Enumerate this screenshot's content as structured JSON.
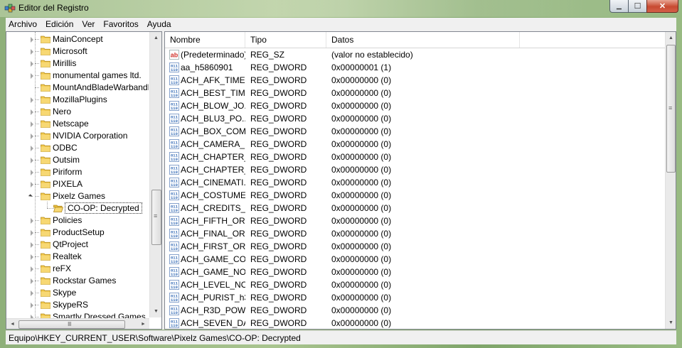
{
  "window": {
    "title": "Editor del Registro",
    "minimize_glyph": "▁",
    "maximize_glyph": "☐",
    "close_glyph": "✕"
  },
  "menu": [
    "Archivo",
    "Edición",
    "Ver",
    "Favoritos",
    "Ayuda"
  ],
  "tree": {
    "items": [
      {
        "label": "MainConcept",
        "state": "collapsed"
      },
      {
        "label": "Microsoft",
        "state": "collapsed"
      },
      {
        "label": "Mirillis",
        "state": "collapsed"
      },
      {
        "label": "monumental games ltd.",
        "state": "collapsed"
      },
      {
        "label": "MountAndBladeWarbandKeys",
        "state": "leaf"
      },
      {
        "label": "MozillaPlugins",
        "state": "collapsed"
      },
      {
        "label": "Nero",
        "state": "collapsed"
      },
      {
        "label": "Netscape",
        "state": "collapsed"
      },
      {
        "label": "NVIDIA Corporation",
        "state": "collapsed"
      },
      {
        "label": "ODBC",
        "state": "collapsed"
      },
      {
        "label": "Outsim",
        "state": "collapsed"
      },
      {
        "label": "Piriform",
        "state": "collapsed"
      },
      {
        "label": "PIXELA",
        "state": "collapsed"
      },
      {
        "label": "Pixelz Games",
        "state": "expanded"
      },
      {
        "label": "CO-OP: Decrypted",
        "state": "selected-child"
      },
      {
        "label": "Policies",
        "state": "collapsed"
      },
      {
        "label": "ProductSetup",
        "state": "collapsed"
      },
      {
        "label": "QtProject",
        "state": "collapsed"
      },
      {
        "label": "Realtek",
        "state": "collapsed"
      },
      {
        "label": "reFX",
        "state": "collapsed"
      },
      {
        "label": "Rockstar Games",
        "state": "collapsed"
      },
      {
        "label": "Skype",
        "state": "collapsed"
      },
      {
        "label": "SkypeRS",
        "state": "collapsed"
      },
      {
        "label": "Smartly Dressed Games",
        "state": "collapsed"
      }
    ],
    "scroll_up_glyph": "▲",
    "scroll_down_glyph": "▼",
    "scroll_left_glyph": "◄",
    "scroll_right_glyph": "►",
    "grip_glyph": "≡",
    "hgrip_glyph": "Ⅲ"
  },
  "list": {
    "columns": [
      "Nombre",
      "Tipo",
      "Datos"
    ],
    "rows": [
      {
        "icon": "string-value-icon",
        "name": "(Predeterminado)",
        "type": "REG_SZ",
        "data": "(valor no establecido)"
      },
      {
        "icon": "binary-value-icon",
        "name": "aa_h5860901",
        "type": "REG_DWORD",
        "data": "0x00000001 (1)"
      },
      {
        "icon": "binary-value-icon",
        "name": "ACH_AFK_TIME...",
        "type": "REG_DWORD",
        "data": "0x00000000 (0)"
      },
      {
        "icon": "binary-value-icon",
        "name": "ACH_BEST_TIM...",
        "type": "REG_DWORD",
        "data": "0x00000000 (0)"
      },
      {
        "icon": "binary-value-icon",
        "name": "ACH_BLOW_JO...",
        "type": "REG_DWORD",
        "data": "0x00000000 (0)"
      },
      {
        "icon": "binary-value-icon",
        "name": "ACH_BLU3_PO...",
        "type": "REG_DWORD",
        "data": "0x00000000 (0)"
      },
      {
        "icon": "binary-value-icon",
        "name": "ACH_BOX_COM...",
        "type": "REG_DWORD",
        "data": "0x00000000 (0)"
      },
      {
        "icon": "binary-value-icon",
        "name": "ACH_CAMERA_...",
        "type": "REG_DWORD",
        "data": "0x00000000 (0)"
      },
      {
        "icon": "binary-value-icon",
        "name": "ACH_CHAPTER_...",
        "type": "REG_DWORD",
        "data": "0x00000000 (0)"
      },
      {
        "icon": "binary-value-icon",
        "name": "ACH_CHAPTER_...",
        "type": "REG_DWORD",
        "data": "0x00000000 (0)"
      },
      {
        "icon": "binary-value-icon",
        "name": "ACH_CINEMATI...",
        "type": "REG_DWORD",
        "data": "0x00000000 (0)"
      },
      {
        "icon": "binary-value-icon",
        "name": "ACH_COSTUME...",
        "type": "REG_DWORD",
        "data": "0x00000000 (0)"
      },
      {
        "icon": "binary-value-icon",
        "name": "ACH_CREDITS_P...",
        "type": "REG_DWORD",
        "data": "0x00000000 (0)"
      },
      {
        "icon": "binary-value-icon",
        "name": "ACH_FIFTH_OR...",
        "type": "REG_DWORD",
        "data": "0x00000000 (0)"
      },
      {
        "icon": "binary-value-icon",
        "name": "ACH_FINAL_OR...",
        "type": "REG_DWORD",
        "data": "0x00000000 (0)"
      },
      {
        "icon": "binary-value-icon",
        "name": "ACH_FIRST_ORB...",
        "type": "REG_DWORD",
        "data": "0x00000000 (0)"
      },
      {
        "icon": "binary-value-icon",
        "name": "ACH_GAME_CO...",
        "type": "REG_DWORD",
        "data": "0x00000000 (0)"
      },
      {
        "icon": "binary-value-icon",
        "name": "ACH_GAME_NO...",
        "type": "REG_DWORD",
        "data": "0x00000000 (0)"
      },
      {
        "icon": "binary-value-icon",
        "name": "ACH_LEVEL_NO...",
        "type": "REG_DWORD",
        "data": "0x00000000 (0)"
      },
      {
        "icon": "binary-value-icon",
        "name": "ACH_PURIST_h3...",
        "type": "REG_DWORD",
        "data": "0x00000000 (0)"
      },
      {
        "icon": "binary-value-icon",
        "name": "ACH_R3D_POW...",
        "type": "REG_DWORD",
        "data": "0x00000000 (0)"
      },
      {
        "icon": "binary-value-icon",
        "name": "ACH_SEVEN_DA...",
        "type": "REG_DWORD",
        "data": "0x00000000 (0)"
      }
    ],
    "scroll_up_glyph": "▲",
    "scroll_down_glyph": "▼",
    "grip_glyph": "≡"
  },
  "status": {
    "path": "Equipo\\HKEY_CURRENT_USER\\Software\\Pixelz Games\\CO-OP: Decrypted"
  },
  "colors": {
    "accent_selection_border": "#333333",
    "folder_yellow": "#f2c94c",
    "binary_icon_blue": "#3a6fb8",
    "string_icon_red": "#d0342c"
  }
}
